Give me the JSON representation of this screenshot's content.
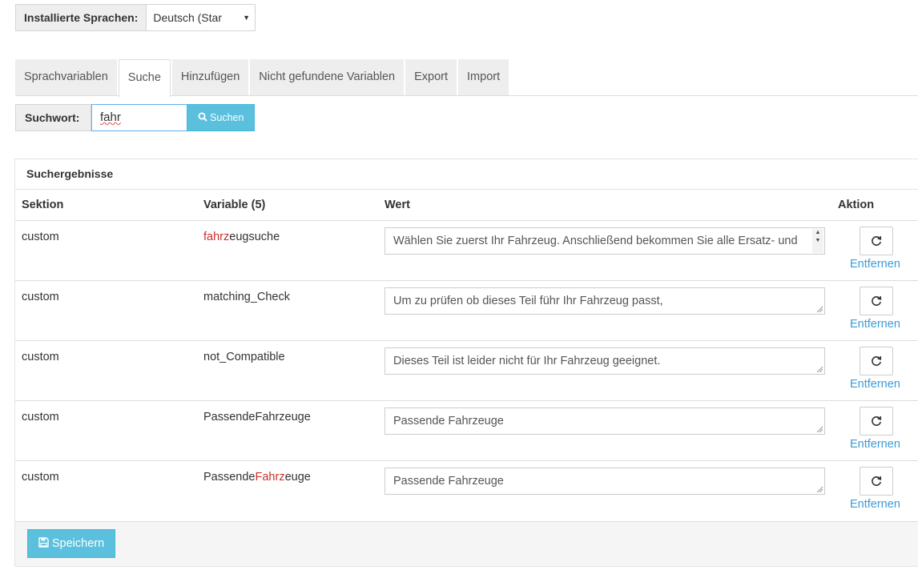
{
  "language": {
    "label": "Installierte Sprachen:",
    "selected": "Deutsch (Star"
  },
  "tabs": [
    {
      "label": "Sprachvariablen"
    },
    {
      "label": "Suche"
    },
    {
      "label": "Hinzufügen"
    },
    {
      "label": "Nicht gefundene Variablen"
    },
    {
      "label": "Export"
    },
    {
      "label": "Import"
    }
  ],
  "active_tab": "Suche",
  "search": {
    "label": "Suchwort:",
    "value": "fahr",
    "button": "Suchen"
  },
  "results": {
    "title": "Suchergebnisse",
    "headers": {
      "section": "Sektion",
      "variable": "Variable (5)",
      "value": "Wert",
      "action": "Aktion"
    },
    "rows": [
      {
        "section": "custom",
        "var_pre": "",
        "var_hl": "fahrz",
        "var_post": "eugsuche",
        "value": "Wählen Sie zuerst Ihr Fahrzeug. Anschließend bekommen Sie alle Ersatz- und",
        "remove": "Entfernen"
      },
      {
        "section": "custom",
        "var_pre": "matching_Check",
        "var_hl": "",
        "var_post": "",
        "value": "Um zu prüfen ob dieses Teil führ Ihr Fahrzeug passt,",
        "remove": "Entfernen"
      },
      {
        "section": "custom",
        "var_pre": "not_Compatible",
        "var_hl": "",
        "var_post": "",
        "value": "Dieses Teil ist leider nicht für Ihr Fahrzeug geeignet.",
        "remove": "Entfernen"
      },
      {
        "section": "custom",
        "var_pre": "PassendeFahrzeuge",
        "var_hl": "",
        "var_post": "",
        "value": "Passende Fahrzeuge",
        "remove": "Entfernen"
      },
      {
        "section": "custom",
        "var_pre": "Passende",
        "var_hl": "Fahrz",
        "var_post": "euge",
        "value": "Passende Fahrzeuge",
        "remove": "Entfernen"
      }
    ]
  },
  "save_button": "Speichern",
  "colors": {
    "accent": "#5bc0de",
    "link": "#3a9bd9",
    "highlight": "#c9302c"
  }
}
